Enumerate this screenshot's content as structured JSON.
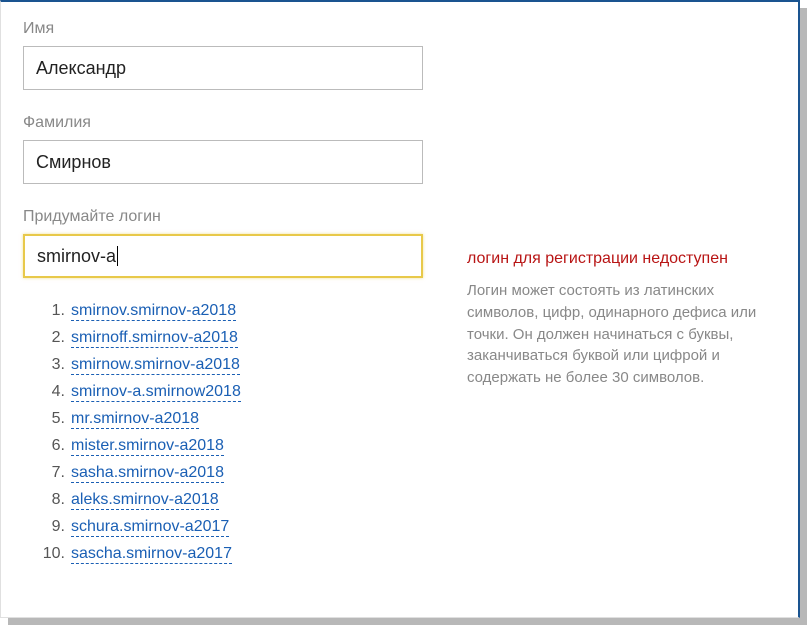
{
  "fields": {
    "firstName": {
      "label": "Имя",
      "value": "Александр"
    },
    "lastName": {
      "label": "Фамилия",
      "value": "Смирнов"
    },
    "login": {
      "label": "Придумайте логин",
      "value": "smirnov-a"
    }
  },
  "suggestions": [
    "smirnov.smirnov-a2018",
    "smirnoff.smirnov-a2018",
    "smirnow.smirnov-a2018",
    "smirnov-a.smirnow2018",
    "mr.smirnov-a2018",
    "mister.smirnov-a2018",
    "sasha.smirnov-a2018",
    "aleks.smirnov-a2018",
    "schura.smirnov-a2017",
    "sascha.smirnov-a2017"
  ],
  "error": {
    "title": "логин для регистрации недоступен",
    "body": "Логин может состоять из латинских символов, цифр, одинарного дефиса или точки. Он должен начинаться с буквы, заканчиваться буквой или цифрой и содержать не более 30 символов."
  }
}
